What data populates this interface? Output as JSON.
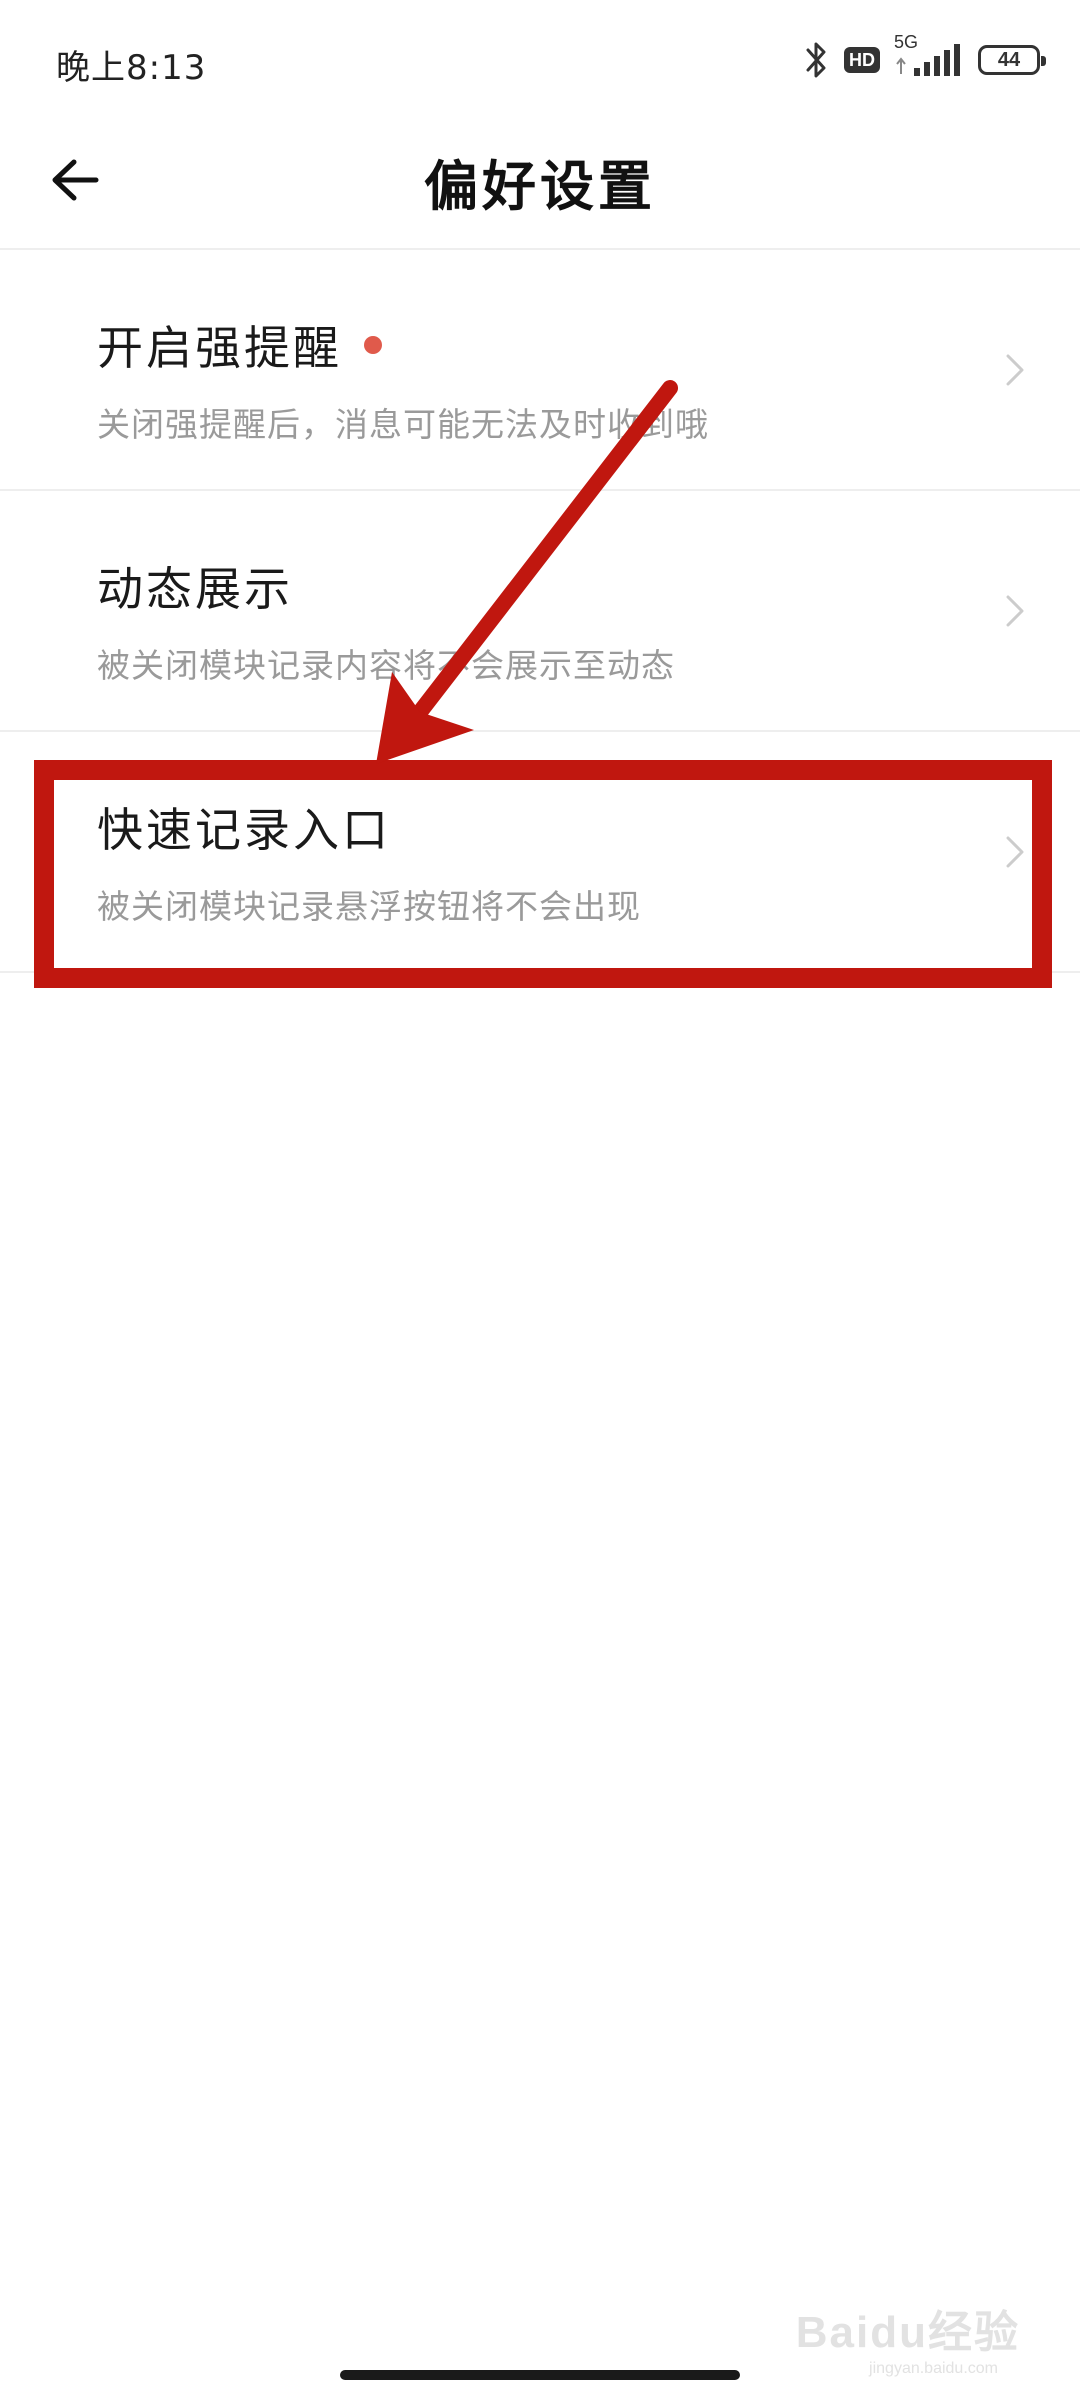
{
  "status_bar": {
    "time": "晚上8:13",
    "hd": "HD",
    "network": "5G",
    "battery": "44"
  },
  "header": {
    "title": "偏好设置",
    "back_icon": "arrow-left-icon"
  },
  "items": [
    {
      "title": "开启强提醒",
      "description": "关闭强提醒后，消息可能无法及时收到哦",
      "has_dot": true,
      "dot_color": "#e05a4b"
    },
    {
      "title": "动态展示",
      "description": "被关闭模块记录内容将不会展示至动态",
      "has_dot": false
    },
    {
      "title": "快速记录入口",
      "description": "被关闭模块记录悬浮按钮将不会出现",
      "has_dot": false
    }
  ],
  "annotation": {
    "color": "#c0170f",
    "highlighted_item": "快速记录入口"
  },
  "watermark": {
    "text": "Baidu经验",
    "sub": "jingyan.baidu.com"
  }
}
